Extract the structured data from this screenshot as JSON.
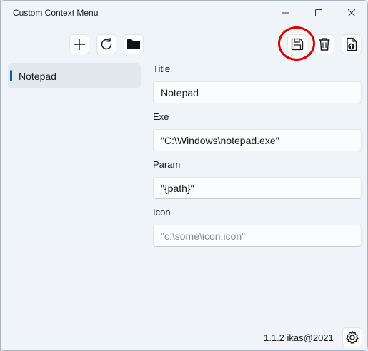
{
  "window": {
    "title": "Custom Context Menu",
    "controls": {
      "minimize_icon": "minimize-icon",
      "maximize_icon": "maximize-icon",
      "close_icon": "close-icon"
    }
  },
  "sidebar": {
    "toolbar": {
      "add_icon": "plus-icon",
      "refresh_icon": "refresh-icon",
      "folder_icon": "folder-icon"
    },
    "items": [
      {
        "label": "Notepad",
        "selected": true
      }
    ]
  },
  "editor": {
    "toolbar": {
      "save_icon": "save-icon",
      "delete_icon": "trash-icon",
      "export_icon": "export-icon"
    },
    "fields": {
      "title": {
        "label": "Title",
        "value": "Notepad",
        "placeholder": ""
      },
      "exe": {
        "label": "Exe",
        "value": "\"C:\\Windows\\notepad.exe\"",
        "placeholder": ""
      },
      "param": {
        "label": "Param",
        "value": "\"{path}\"",
        "placeholder": ""
      },
      "icon": {
        "label": "Icon",
        "value": "",
        "placeholder": "\"c:\\some\\icon.icon\""
      }
    }
  },
  "footer": {
    "version": "1.1.2 ikas@2021",
    "settings_icon": "gear-icon"
  },
  "colors": {
    "accent": "#005fb8",
    "highlight": "#e00000"
  }
}
